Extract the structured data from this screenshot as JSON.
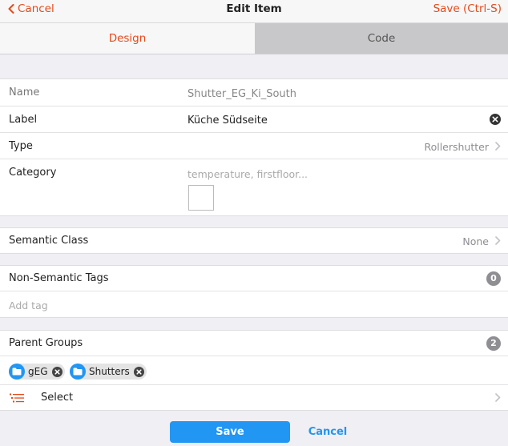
{
  "navbar": {
    "back_label": "Cancel",
    "title": "Edit Item",
    "save_label": "Save (Ctrl-S)"
  },
  "tabs": [
    {
      "label": "Design",
      "active": true
    },
    {
      "label": "Code",
      "active": false
    }
  ],
  "item": {
    "name_label": "Name",
    "name_value": "Shutter_EG_Ki_South",
    "label_label": "Label",
    "label_value": "Küche Südseite",
    "type_label": "Type",
    "type_value": "Rollershutter",
    "category_label": "Category",
    "category_placeholder": "temperature, firstfloor..."
  },
  "semantic": {
    "label": "Semantic Class",
    "value": "None"
  },
  "tags": {
    "label": "Non-Semantic Tags",
    "count": "0",
    "add_placeholder": "Add tag"
  },
  "groups": {
    "label": "Parent Groups",
    "count": "2",
    "chips": [
      "gEG",
      "Shutters"
    ],
    "select_label": "Select"
  },
  "footer": {
    "save_label": "Save",
    "cancel_label": "Cancel"
  },
  "colors": {
    "accent": "#e64a19",
    "primary": "#2196f3",
    "background": "#efeff4"
  }
}
